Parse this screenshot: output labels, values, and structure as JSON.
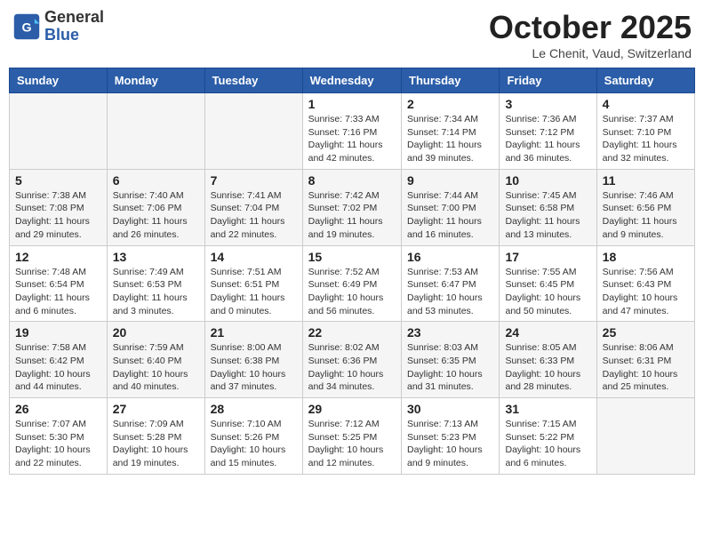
{
  "header": {
    "logo_general": "General",
    "logo_blue": "Blue",
    "month_title": "October 2025",
    "location": "Le Chenit, Vaud, Switzerland"
  },
  "weekdays": [
    "Sunday",
    "Monday",
    "Tuesday",
    "Wednesday",
    "Thursday",
    "Friday",
    "Saturday"
  ],
  "weeks": [
    [
      {
        "day": "",
        "empty": true
      },
      {
        "day": "",
        "empty": true
      },
      {
        "day": "",
        "empty": true
      },
      {
        "day": "1",
        "sunrise": "Sunrise: 7:33 AM",
        "sunset": "Sunset: 7:16 PM",
        "daylight": "Daylight: 11 hours and 42 minutes."
      },
      {
        "day": "2",
        "sunrise": "Sunrise: 7:34 AM",
        "sunset": "Sunset: 7:14 PM",
        "daylight": "Daylight: 11 hours and 39 minutes."
      },
      {
        "day": "3",
        "sunrise": "Sunrise: 7:36 AM",
        "sunset": "Sunset: 7:12 PM",
        "daylight": "Daylight: 11 hours and 36 minutes."
      },
      {
        "day": "4",
        "sunrise": "Sunrise: 7:37 AM",
        "sunset": "Sunset: 7:10 PM",
        "daylight": "Daylight: 11 hours and 32 minutes."
      }
    ],
    [
      {
        "day": "5",
        "sunrise": "Sunrise: 7:38 AM",
        "sunset": "Sunset: 7:08 PM",
        "daylight": "Daylight: 11 hours and 29 minutes."
      },
      {
        "day": "6",
        "sunrise": "Sunrise: 7:40 AM",
        "sunset": "Sunset: 7:06 PM",
        "daylight": "Daylight: 11 hours and 26 minutes."
      },
      {
        "day": "7",
        "sunrise": "Sunrise: 7:41 AM",
        "sunset": "Sunset: 7:04 PM",
        "daylight": "Daylight: 11 hours and 22 minutes."
      },
      {
        "day": "8",
        "sunrise": "Sunrise: 7:42 AM",
        "sunset": "Sunset: 7:02 PM",
        "daylight": "Daylight: 11 hours and 19 minutes."
      },
      {
        "day": "9",
        "sunrise": "Sunrise: 7:44 AM",
        "sunset": "Sunset: 7:00 PM",
        "daylight": "Daylight: 11 hours and 16 minutes."
      },
      {
        "day": "10",
        "sunrise": "Sunrise: 7:45 AM",
        "sunset": "Sunset: 6:58 PM",
        "daylight": "Daylight: 11 hours and 13 minutes."
      },
      {
        "day": "11",
        "sunrise": "Sunrise: 7:46 AM",
        "sunset": "Sunset: 6:56 PM",
        "daylight": "Daylight: 11 hours and 9 minutes."
      }
    ],
    [
      {
        "day": "12",
        "sunrise": "Sunrise: 7:48 AM",
        "sunset": "Sunset: 6:54 PM",
        "daylight": "Daylight: 11 hours and 6 minutes."
      },
      {
        "day": "13",
        "sunrise": "Sunrise: 7:49 AM",
        "sunset": "Sunset: 6:53 PM",
        "daylight": "Daylight: 11 hours and 3 minutes."
      },
      {
        "day": "14",
        "sunrise": "Sunrise: 7:51 AM",
        "sunset": "Sunset: 6:51 PM",
        "daylight": "Daylight: 11 hours and 0 minutes."
      },
      {
        "day": "15",
        "sunrise": "Sunrise: 7:52 AM",
        "sunset": "Sunset: 6:49 PM",
        "daylight": "Daylight: 10 hours and 56 minutes."
      },
      {
        "day": "16",
        "sunrise": "Sunrise: 7:53 AM",
        "sunset": "Sunset: 6:47 PM",
        "daylight": "Daylight: 10 hours and 53 minutes."
      },
      {
        "day": "17",
        "sunrise": "Sunrise: 7:55 AM",
        "sunset": "Sunset: 6:45 PM",
        "daylight": "Daylight: 10 hours and 50 minutes."
      },
      {
        "day": "18",
        "sunrise": "Sunrise: 7:56 AM",
        "sunset": "Sunset: 6:43 PM",
        "daylight": "Daylight: 10 hours and 47 minutes."
      }
    ],
    [
      {
        "day": "19",
        "sunrise": "Sunrise: 7:58 AM",
        "sunset": "Sunset: 6:42 PM",
        "daylight": "Daylight: 10 hours and 44 minutes."
      },
      {
        "day": "20",
        "sunrise": "Sunrise: 7:59 AM",
        "sunset": "Sunset: 6:40 PM",
        "daylight": "Daylight: 10 hours and 40 minutes."
      },
      {
        "day": "21",
        "sunrise": "Sunrise: 8:00 AM",
        "sunset": "Sunset: 6:38 PM",
        "daylight": "Daylight: 10 hours and 37 minutes."
      },
      {
        "day": "22",
        "sunrise": "Sunrise: 8:02 AM",
        "sunset": "Sunset: 6:36 PM",
        "daylight": "Daylight: 10 hours and 34 minutes."
      },
      {
        "day": "23",
        "sunrise": "Sunrise: 8:03 AM",
        "sunset": "Sunset: 6:35 PM",
        "daylight": "Daylight: 10 hours and 31 minutes."
      },
      {
        "day": "24",
        "sunrise": "Sunrise: 8:05 AM",
        "sunset": "Sunset: 6:33 PM",
        "daylight": "Daylight: 10 hours and 28 minutes."
      },
      {
        "day": "25",
        "sunrise": "Sunrise: 8:06 AM",
        "sunset": "Sunset: 6:31 PM",
        "daylight": "Daylight: 10 hours and 25 minutes."
      }
    ],
    [
      {
        "day": "26",
        "sunrise": "Sunrise: 7:07 AM",
        "sunset": "Sunset: 5:30 PM",
        "daylight": "Daylight: 10 hours and 22 minutes."
      },
      {
        "day": "27",
        "sunrise": "Sunrise: 7:09 AM",
        "sunset": "Sunset: 5:28 PM",
        "daylight": "Daylight: 10 hours and 19 minutes."
      },
      {
        "day": "28",
        "sunrise": "Sunrise: 7:10 AM",
        "sunset": "Sunset: 5:26 PM",
        "daylight": "Daylight: 10 hours and 15 minutes."
      },
      {
        "day": "29",
        "sunrise": "Sunrise: 7:12 AM",
        "sunset": "Sunset: 5:25 PM",
        "daylight": "Daylight: 10 hours and 12 minutes."
      },
      {
        "day": "30",
        "sunrise": "Sunrise: 7:13 AM",
        "sunset": "Sunset: 5:23 PM",
        "daylight": "Daylight: 10 hours and 9 minutes."
      },
      {
        "day": "31",
        "sunrise": "Sunrise: 7:15 AM",
        "sunset": "Sunset: 5:22 PM",
        "daylight": "Daylight: 10 hours and 6 minutes."
      },
      {
        "day": "",
        "empty": true
      }
    ]
  ]
}
